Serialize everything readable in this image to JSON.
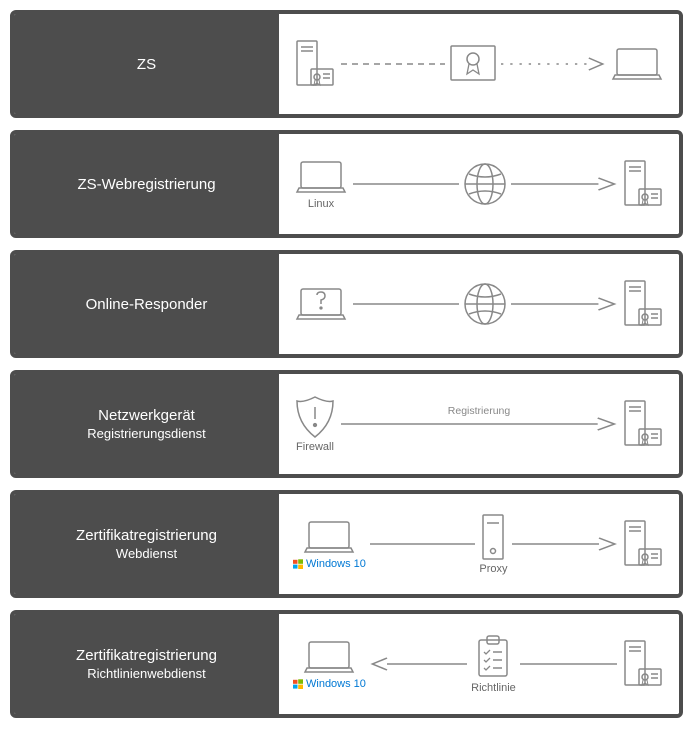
{
  "rows": [
    {
      "title": "ZS",
      "subtitle": ""
    },
    {
      "title": "ZS-Webregistrierung",
      "subtitle": ""
    },
    {
      "title": "Online-Responder",
      "subtitle": ""
    },
    {
      "title": "Netzwerkgerät",
      "subtitle": "Registrierungsdienst"
    },
    {
      "title": "Zertifikatregistrierung",
      "subtitle": "Webdienst"
    },
    {
      "title": "Zertifikatregistrierung",
      "subtitle": "Richtlinienwebdienst"
    }
  ],
  "captions": {
    "linux": "Linux",
    "firewall": "Firewall",
    "registration": "Registrierung",
    "windows10": "Windows 10",
    "proxy": "Proxy",
    "policy": "Richtlinie"
  }
}
